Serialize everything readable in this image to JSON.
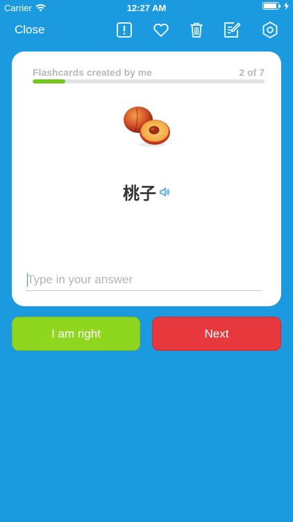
{
  "status_bar": {
    "carrier": "Carrier",
    "time": "12:27 AM",
    "battery_level": 0.9
  },
  "toolbar": {
    "close_label": "Close",
    "icons": [
      "report-icon",
      "heart-icon",
      "trash-icon",
      "edit-icon",
      "settings-icon"
    ]
  },
  "card": {
    "deck_label": "Flashcards created by me",
    "progress_text": "2 of 7",
    "progress_fraction": 0.14,
    "word": "桃子",
    "image_icon": "peach-icon",
    "answer_placeholder": "Type in your answer",
    "answer_value": ""
  },
  "buttons": {
    "right_label": "I am right",
    "next_label": "Next"
  },
  "colors": {
    "background": "#1b9ae0",
    "card": "#ffffff",
    "progress": "#78c623",
    "right_button": "#8fd61f",
    "next_button": "#e7393d"
  }
}
